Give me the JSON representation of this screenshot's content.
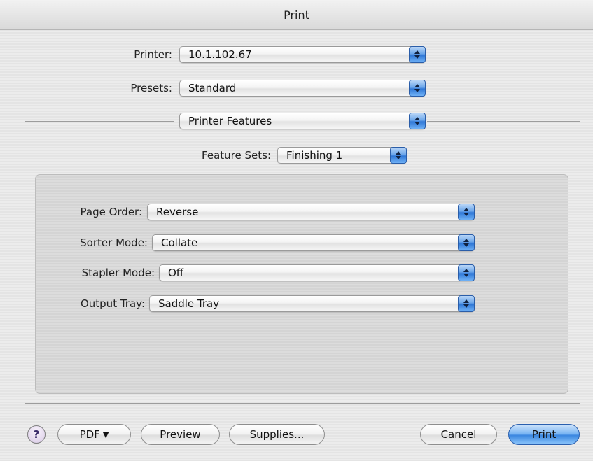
{
  "window": {
    "title": "Print"
  },
  "printer": {
    "label": "Printer:",
    "value": "10.1.102.67"
  },
  "presets": {
    "label": "Presets:",
    "value": "Standard"
  },
  "pane": {
    "value": "Printer Features"
  },
  "feature_sets": {
    "label": "Feature Sets:",
    "value": "Finishing 1"
  },
  "features": [
    {
      "label": "Page Order:",
      "value": "Reverse"
    },
    {
      "label": "Sorter Mode:",
      "value": "Collate"
    },
    {
      "label": "Stapler Mode:",
      "value": "Off"
    },
    {
      "label": "Output Tray:",
      "value": "Saddle Tray"
    }
  ],
  "buttons": {
    "help": "?",
    "pdf": "PDF",
    "pdf_caret": "▼",
    "preview": "Preview",
    "supplies": "Supplies...",
    "cancel": "Cancel",
    "print": "Print"
  },
  "colors": {
    "accent": "#3a86e0",
    "stepper_blue": "#2f77d6"
  },
  "icons": {
    "stepper": "up-down-arrows-icon",
    "help": "question-mark-icon",
    "pdf_menu": "triangle-down-icon"
  }
}
